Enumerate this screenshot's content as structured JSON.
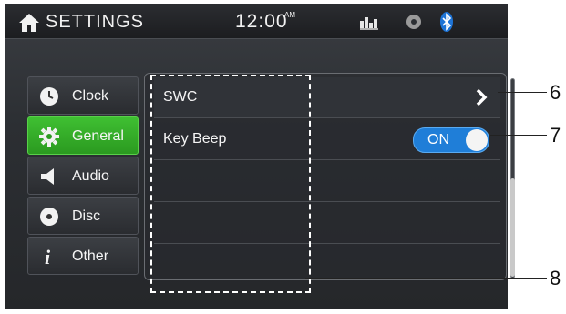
{
  "status_bar": {
    "title": "SETTINGS",
    "time": "12:00",
    "ampm": "AM",
    "icons": [
      "home-icon",
      "equalizer-icon",
      "disc-icon",
      "bluetooth-icon"
    ]
  },
  "sidebar": {
    "items": [
      {
        "label": "Clock",
        "icon": "clock-icon",
        "active": false
      },
      {
        "label": "General",
        "icon": "gear-icon",
        "active": true
      },
      {
        "label": "Audio",
        "icon": "speaker-icon",
        "active": false
      },
      {
        "label": "Disc",
        "icon": "disc-icon",
        "active": false
      },
      {
        "label": "Other",
        "icon": "info-icon",
        "active": false
      }
    ]
  },
  "list": {
    "rows": [
      {
        "label": "SWC",
        "control": "chevron-right-icon"
      },
      {
        "label": "Key Beep",
        "control": "toggle",
        "value": "ON"
      },
      {
        "label": ""
      },
      {
        "label": ""
      },
      {
        "label": ""
      }
    ]
  },
  "callouts": [
    "6",
    "7",
    "8"
  ],
  "colors": {
    "accent_green": "#3fbf32",
    "toggle_blue": "#1f7ed8",
    "bluetooth_blue": "#1e74d6"
  }
}
